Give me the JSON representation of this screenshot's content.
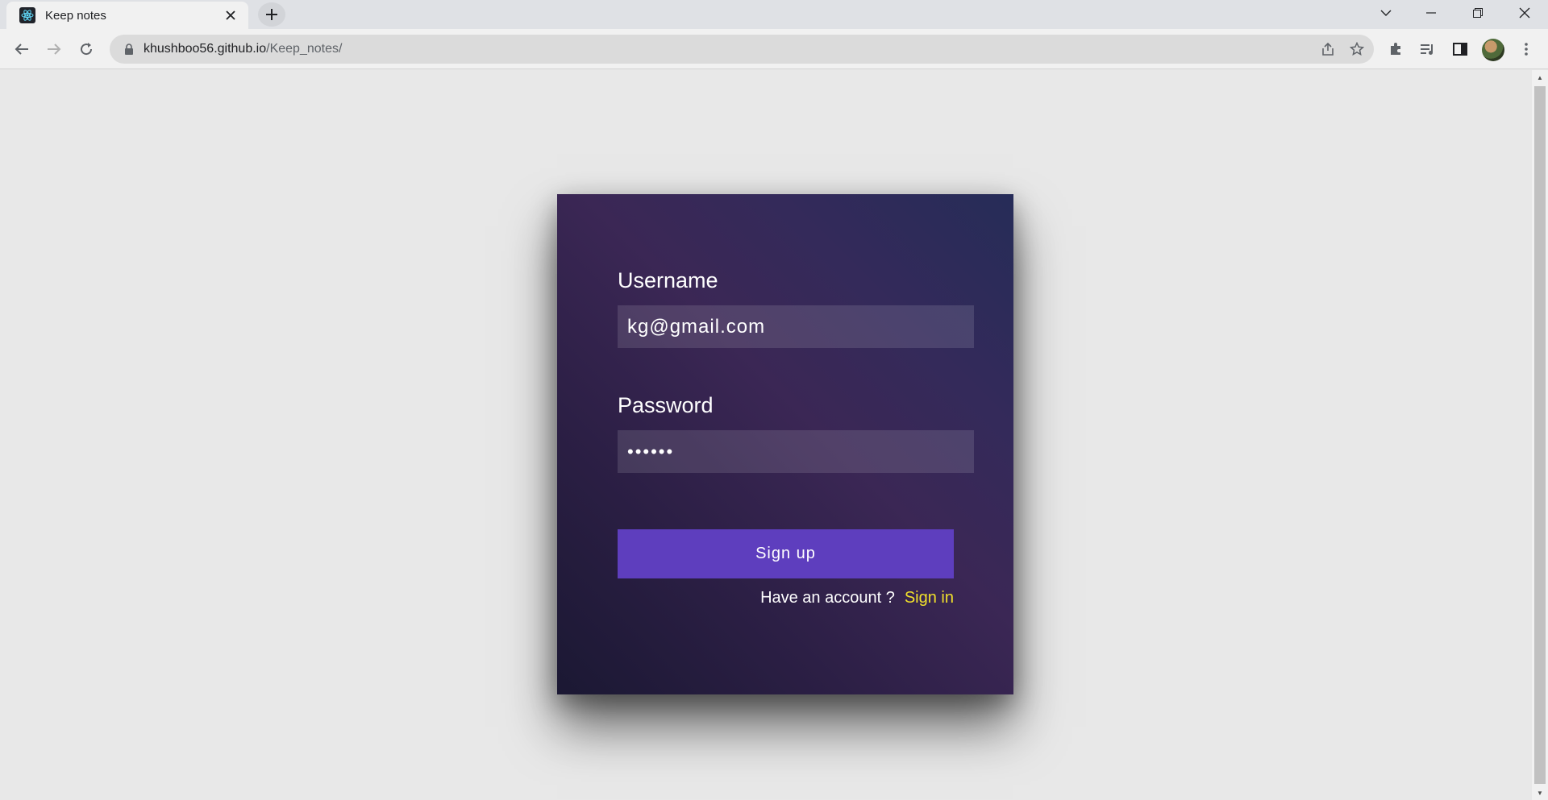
{
  "browser": {
    "tab_title": "Keep notes",
    "url_host": "khushboo56.github.io",
    "url_path": "/Keep_notes/"
  },
  "form": {
    "username_label": "Username",
    "username_value": "kg@gmail.com",
    "password_label": "Password",
    "password_value": "••••••",
    "submit_label": "Sign up",
    "footer_text": "Have an account ?",
    "footer_link": "Sign in"
  },
  "colors": {
    "button": "#5e3ebe",
    "link": "#f1e12b",
    "page_bg": "#e8e8e8"
  }
}
